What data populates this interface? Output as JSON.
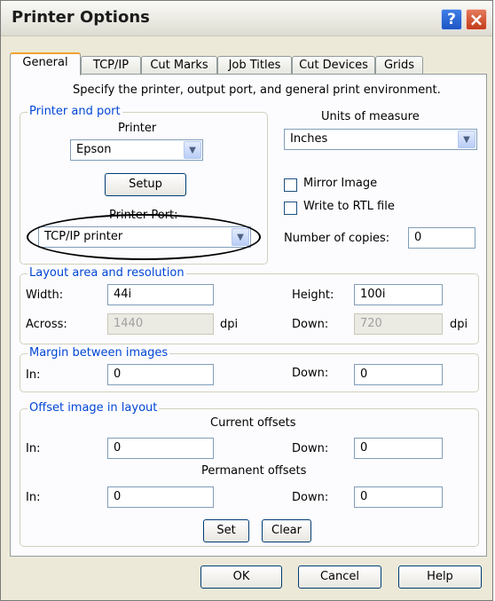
{
  "window": {
    "title": "Printer Options",
    "help_glyph": "?",
    "close_glyph": "×"
  },
  "tabs": [
    "General",
    "TCP/IP",
    "Cut Marks",
    "Job Titles",
    "Cut Devices",
    "Grids"
  ],
  "active_tab": "General",
  "description": "Specify the printer, output port, and general print environment.",
  "printer_and_port": {
    "group_title": "Printer and port",
    "printer_label": "Printer",
    "printer_value": "Epson",
    "setup_label": "Setup",
    "port_label": "Printer Port:",
    "port_value": "TCP/IP printer"
  },
  "units": {
    "label": "Units of measure",
    "value": "Inches"
  },
  "options": {
    "mirror_label": "Mirror Image",
    "mirror_checked": false,
    "rtl_label": "Write to RTL file",
    "rtl_checked": false,
    "copies_label": "Number of copies:",
    "copies_value": "0"
  },
  "layout": {
    "group_title": "Layout area and resolution",
    "width_label": "Width:",
    "width_value": "44i",
    "height_label": "Height:",
    "height_value": "100i",
    "across_label": "Across:",
    "across_value": "1440",
    "down_label": "Down:",
    "down_value": "720",
    "dpi_label": "dpi"
  },
  "margin": {
    "group_title": "Margin between images",
    "in_label": "In:",
    "in_value": "0",
    "down_label": "Down:",
    "down_value": "0"
  },
  "offset": {
    "group_title": "Offset image in layout",
    "current_label": "Current offsets",
    "current_in_label": "In:",
    "current_in_value": "0",
    "current_down_label": "Down:",
    "current_down_value": "0",
    "permanent_label": "Permanent offsets",
    "permanent_in_label": "In:",
    "permanent_in_value": "0",
    "permanent_down_label": "Down:",
    "permanent_down_value": "0",
    "set_label": "Set",
    "clear_label": "Clear"
  },
  "footer": {
    "ok_label": "OK",
    "cancel_label": "Cancel",
    "help_label": "Help"
  },
  "icons": {
    "dropdown": "chevron-down-icon",
    "help": "help-icon",
    "close": "close-icon"
  },
  "colors": {
    "group_title": "#0046d5",
    "active_tab_accent": "#f1a22f",
    "dialog_bg": "#ece9d8"
  }
}
